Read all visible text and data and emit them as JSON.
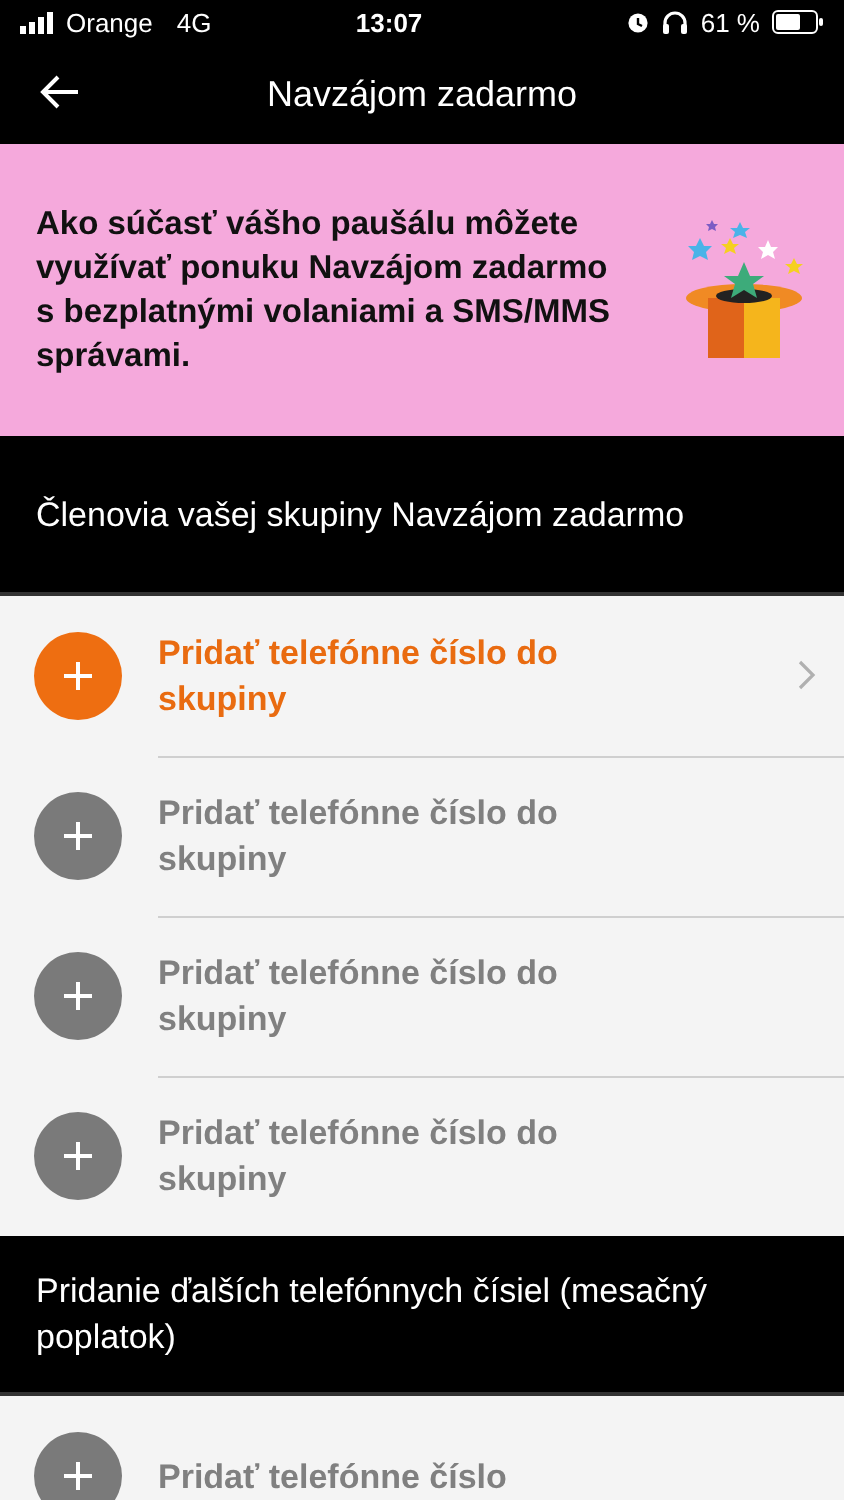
{
  "status_bar": {
    "carrier": "Orange",
    "network": "4G",
    "time": "13:07",
    "battery": "61 %"
  },
  "nav": {
    "title": "Navzájom zadarmo"
  },
  "banner": {
    "text": "Ako súčasť vášho paušálu môžete využívať ponuku Navzájom zadarmo s bezplatnými volaniami a SMS/MMS správami."
  },
  "sections": [
    {
      "title": "Členovia vašej skupiny Navzájom zadarmo",
      "rows": [
        {
          "label": "Pridať telefónne číslo do skupiny",
          "active": true
        },
        {
          "label": "Pridať telefónne číslo do skupiny",
          "active": false
        },
        {
          "label": "Pridať telefónne číslo do skupiny",
          "active": false
        },
        {
          "label": "Pridať telefónne číslo do skupiny",
          "active": false
        }
      ]
    },
    {
      "title": "Pridanie ďalších telefónnych čísiel (mesačný poplatok)",
      "rows": [
        {
          "label": "Pridať telefónne číslo",
          "active": false
        }
      ]
    }
  ]
}
